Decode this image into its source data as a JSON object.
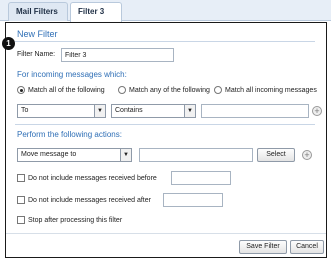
{
  "tabs": [
    {
      "label": "Mail Filters"
    },
    {
      "label": "Filter 3",
      "close_icon": "⊗"
    }
  ],
  "form": {
    "title": "New Filter",
    "filter_name_label": "Filter Name:",
    "filter_name_value": "Filter 3",
    "incoming_title": "For incoming messages which:",
    "match_all_label": "Match all of the following",
    "match_any_label": "Match any of the following",
    "match_all_incoming_label": "Match all incoming messages",
    "selected_match": "Match all of the following",
    "condition_field": "To",
    "condition_operator": "Contains",
    "condition_value": "",
    "actions_title": "Perform the following actions:",
    "action": "Move message to",
    "action_target": "",
    "select_button": "Select",
    "exclude_before_label": "Do not include messages received before",
    "exclude_after_label": "Do not include messages received after",
    "stop_label": "Stop after processing this filter",
    "save_button": "Save Filter",
    "cancel_button": "Cancel",
    "callout_number": "1"
  },
  "colors": {
    "accent": "#2f6fb6",
    "tabbar_bg": "#e7eef7"
  }
}
